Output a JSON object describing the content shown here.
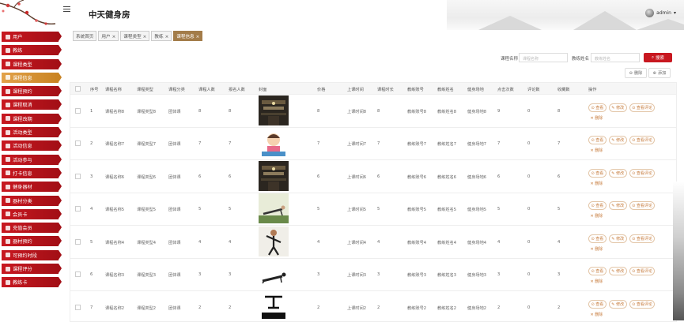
{
  "header": {
    "title": "中天健身房",
    "user": "admin",
    "dropdown_glyph": "▾"
  },
  "sidebar": {
    "items": [
      {
        "label": "用户",
        "icon": "user-icon"
      },
      {
        "label": "教练",
        "icon": "coach-icon"
      },
      {
        "label": "课程类型",
        "icon": "category-icon"
      },
      {
        "label": "课程信息",
        "icon": "course-icon",
        "active": true
      },
      {
        "label": "课程预约",
        "icon": "calendar-icon"
      },
      {
        "label": "课程取消",
        "icon": "cancel-icon"
      },
      {
        "label": "课程改期",
        "icon": "reschedule-icon"
      },
      {
        "label": "活动类型",
        "icon": "activity-type-icon"
      },
      {
        "label": "活动信息",
        "icon": "activity-icon"
      },
      {
        "label": "活动参与",
        "icon": "participate-icon"
      },
      {
        "label": "打卡信息",
        "icon": "checkin-icon"
      },
      {
        "label": "健身器材",
        "icon": "equipment-icon"
      },
      {
        "label": "器材分类",
        "icon": "equipment-category-icon"
      },
      {
        "label": "会员卡",
        "icon": "card-icon"
      },
      {
        "label": "充值会员",
        "icon": "recharge-icon"
      },
      {
        "label": "器材预约",
        "icon": "equipment-booking-icon"
      },
      {
        "label": "可预约时段",
        "icon": "timeslot-icon"
      },
      {
        "label": "课程评分",
        "icon": "rating-icon"
      },
      {
        "label": "教练卡",
        "icon": "coach-card-icon"
      }
    ]
  },
  "tabs": [
    {
      "label": "系统首页",
      "closable": false
    },
    {
      "label": "用户",
      "closable": true
    },
    {
      "label": "课程类型",
      "closable": true
    },
    {
      "label": "教练",
      "closable": true
    },
    {
      "label": "课程信息",
      "closable": true,
      "active": true
    }
  ],
  "tab_close_glyph": "×",
  "search": {
    "course_name_label": "课程名称",
    "course_name_placeholder": "课程名称",
    "coach_name_label": "教练姓名",
    "coach_name_placeholder": "教练姓名",
    "search_button": "搜索"
  },
  "actions": {
    "delete": "删除",
    "add": "添加"
  },
  "table": {
    "columns": [
      "序号",
      "课程名称",
      "课程类型",
      "课程分类",
      "课程人数",
      "报名人数",
      "封面",
      "价格",
      "上课时间",
      "课程时长",
      "教练账号",
      "教练姓名",
      "健身场地",
      "点击次数",
      "评论数",
      "收藏数",
      "操作"
    ],
    "row_ops": {
      "view": "查看",
      "edit": "修改",
      "review": "查看评论",
      "delete": "删除"
    },
    "rows": [
      {
        "idx": "1",
        "name": "课程名称8",
        "type": "课程类型8",
        "cls": "团体课",
        "cap": "8",
        "enrolled": "8",
        "cover": "gym",
        "price": "8",
        "time": "上课时间8",
        "dur": "8",
        "acct": "教练账号8",
        "coach": "教练姓名8",
        "venue": "健身场地8",
        "clicks": "9",
        "comments": "0",
        "favs": "8"
      },
      {
        "idx": "2",
        "name": "课程名称7",
        "type": "课程类型7",
        "cls": "团体课",
        "cap": "7",
        "enrolled": "7",
        "cover": "cartoon",
        "price": "7",
        "time": "上课时间7",
        "dur": "7",
        "acct": "教练账号7",
        "coach": "教练姓名7",
        "venue": "健身场地7",
        "clicks": "7",
        "comments": "0",
        "favs": "7"
      },
      {
        "idx": "3",
        "name": "课程名称6",
        "type": "课程类型6",
        "cls": "团体课",
        "cap": "6",
        "enrolled": "6",
        "cover": "gym",
        "price": "6",
        "time": "上课时间6",
        "dur": "6",
        "acct": "教练账号6",
        "coach": "教练姓名6",
        "venue": "健身场地6",
        "clicks": "6",
        "comments": "0",
        "favs": "6"
      },
      {
        "idx": "4",
        "name": "课程名称5",
        "type": "课程类型5",
        "cls": "团体课",
        "cap": "5",
        "enrolled": "5",
        "cover": "pushup",
        "price": "5",
        "time": "上课时间5",
        "dur": "5",
        "acct": "教练账号5",
        "coach": "教练姓名5",
        "venue": "健身场地5",
        "clicks": "5",
        "comments": "0",
        "favs": "5"
      },
      {
        "idx": "5",
        "name": "课程名称4",
        "type": "课程类型4",
        "cls": "团体课",
        "cap": "4",
        "enrolled": "4",
        "cover": "athlete",
        "price": "4",
        "time": "上课时间4",
        "dur": "4",
        "acct": "教练账号4",
        "coach": "教练姓名4",
        "venue": "健身场地4",
        "clicks": "4",
        "comments": "0",
        "favs": "4"
      },
      {
        "idx": "6",
        "name": "课程名称3",
        "type": "课程类型3",
        "cls": "团体课",
        "cap": "3",
        "enrolled": "3",
        "cover": "plank",
        "price": "3",
        "time": "上课时间3",
        "dur": "3",
        "acct": "教练账号3",
        "coach": "教练姓名3",
        "venue": "健身场地3",
        "clicks": "3",
        "comments": "0",
        "favs": "3"
      },
      {
        "idx": "7",
        "name": "课程名称2",
        "type": "课程类型2",
        "cls": "团体课",
        "cap": "2",
        "enrolled": "2",
        "cover": "wswcf",
        "price": "2",
        "time": "上课时间2",
        "dur": "2",
        "acct": "教练账号2",
        "coach": "教练姓名2",
        "venue": "健身场地2",
        "clicks": "2",
        "comments": "0",
        "favs": "2"
      }
    ]
  },
  "colors": {
    "sidebar_red": "#c81820",
    "active_gold": "#c98322",
    "search_red": "#c81820",
    "tab_active": "#a37c49"
  }
}
